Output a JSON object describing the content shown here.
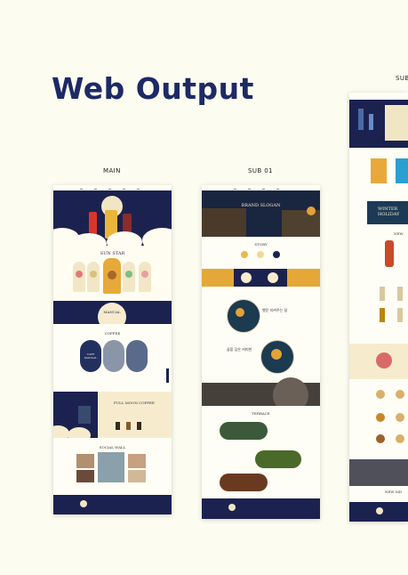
{
  "title": "Web Output",
  "columns": {
    "main": {
      "label": "MAIN",
      "sections": {
        "sunstar": "SUN STAR",
        "manual_top": "MANUAL",
        "manual_sub": "COFFEE",
        "cafe_manual": "CAFE MANUAL",
        "full_moon": "FULL MOON COFFEE",
        "social_wall": "SOCIAL WALL"
      }
    },
    "sub01": {
      "label": "SUB 01",
      "sections": {
        "hero": "BRAND SLOGAN",
        "story": "STORY",
        "circle_a": "행운 지켜주는 달",
        "circle_b": "꿈을 담은 커피한",
        "terrace": "TERRACE"
      }
    },
    "sub02": {
      "label": "SUB",
      "sections": {
        "winter": "WINTER HOLIDAY",
        "new": "NEW",
        "new_menu": "NEW MD"
      }
    }
  },
  "colors": {
    "title": "#1d2a66",
    "navy": "#1c2250",
    "cream": "#f6eccd",
    "gold": "#e4a838",
    "background": "#fcfcf0"
  }
}
